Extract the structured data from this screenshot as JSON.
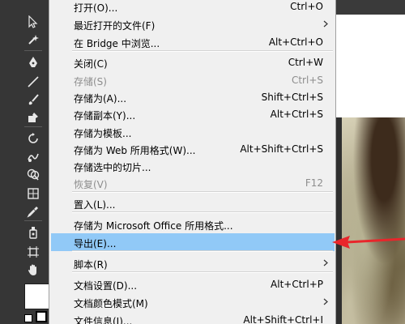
{
  "menu": {
    "items": [
      {
        "label": "打开(O)...",
        "shortcut": "Ctrl+O",
        "disabled": false,
        "submenu": false
      },
      {
        "label": "最近打开的文件(F)",
        "shortcut": "",
        "disabled": false,
        "submenu": true
      },
      {
        "label": "在 Bridge 中浏览...",
        "shortcut": "Alt+Ctrl+O",
        "disabled": false,
        "submenu": false
      },
      {
        "label": "关闭(C)",
        "shortcut": "Ctrl+W",
        "disabled": false,
        "submenu": false
      },
      {
        "label": "存储(S)",
        "shortcut": "Ctrl+S",
        "disabled": true,
        "submenu": false
      },
      {
        "label": "存储为(A)...",
        "shortcut": "Shift+Ctrl+S",
        "disabled": false,
        "submenu": false
      },
      {
        "label": "存储副本(Y)...",
        "shortcut": "Alt+Ctrl+S",
        "disabled": false,
        "submenu": false
      },
      {
        "label": "存储为模板...",
        "shortcut": "",
        "disabled": false,
        "submenu": false
      },
      {
        "label": "存储为 Web 所用格式(W)...",
        "shortcut": "Alt+Shift+Ctrl+S",
        "disabled": false,
        "submenu": false
      },
      {
        "label": "存储选中的切片...",
        "shortcut": "",
        "disabled": false,
        "submenu": false
      },
      {
        "label": "恢复(V)",
        "shortcut": "F12",
        "disabled": true,
        "submenu": false
      },
      {
        "label": "置入(L)...",
        "shortcut": "",
        "disabled": false,
        "submenu": false
      },
      {
        "label": "存储为 Microsoft Office 所用格式...",
        "shortcut": "",
        "disabled": false,
        "submenu": false
      },
      {
        "label": "导出(E)...",
        "shortcut": "",
        "disabled": false,
        "submenu": false,
        "highlighted": true
      },
      {
        "label": "脚本(R)",
        "shortcut": "",
        "disabled": false,
        "submenu": true
      },
      {
        "label": "文档设置(D)...",
        "shortcut": "Alt+Ctrl+P",
        "disabled": false,
        "submenu": false
      },
      {
        "label": "文档颜色模式(M)",
        "shortcut": "",
        "disabled": false,
        "submenu": true
      },
      {
        "label": "文件信息(I)...",
        "shortcut": "Alt+Shift+Ctrl+I",
        "disabled": false,
        "submenu": false
      }
    ]
  },
  "tools": [
    "selection-tool-icon",
    "magic-wand-icon",
    "pen-tool-icon",
    "line-tool-icon",
    "paintbrush-icon",
    "blob-brush-icon",
    "rotate-tool-icon",
    "warp-tool-icon",
    "shape-builder-icon",
    "gradient-mesh-icon",
    "eyedropper-icon",
    "symbol-sprayer-icon",
    "artboard-tool-icon",
    "hand-tool-icon"
  ],
  "colors": {
    "menu_background": "#f0f0f0",
    "highlight": "#91c9f7",
    "disabled_text": "#8d8d8d",
    "annotation_arrow": "#e8262b",
    "tools_panel": "#363636"
  }
}
